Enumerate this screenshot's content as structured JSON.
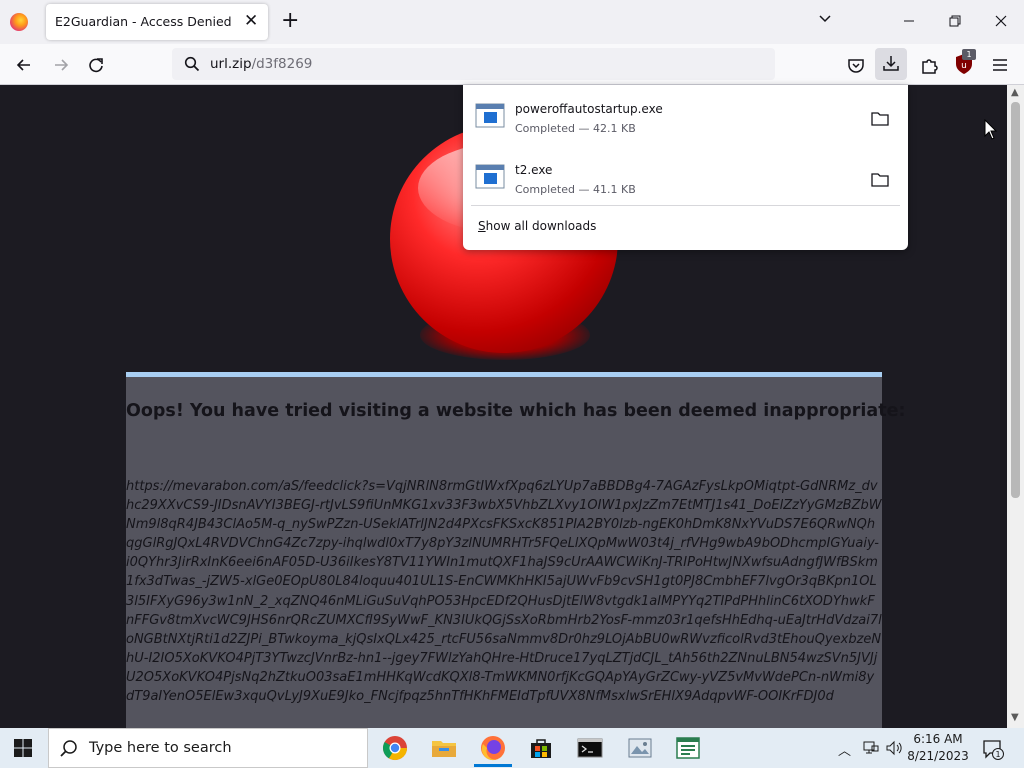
{
  "browser": {
    "tab_title": "E2Guardian - Access Denied",
    "url_host": "url.zip",
    "url_path": "/d3f8269",
    "addon_badge": "1"
  },
  "downloads": {
    "items": [
      {
        "name": "poweroffautostartup.exe",
        "status": "Completed — 42.1 KB"
      },
      {
        "name": "t2.exe",
        "status": "Completed — 41.1 KB"
      }
    ],
    "show_all_prefix": "S",
    "show_all_rest": "how all downloads"
  },
  "page": {
    "headline": "Oops! You have tried visiting a website which has been deemed inappropriate:",
    "blocked_url": "https://mevarabon.com/aS/feedclick?s=VqjNRlN8rmGtIWxfXpq6zLYUp7aBBDBg4-7AGAzFysLkpOMiqtpt-GdNRMz_dvhc29XXvCS9-JIDsnAVYI3BEGJ-rtJvLS9fiUnMKG1xv33F3wbX5VhbZLXvy1OIW1pxJzZm7EtMTJ1s41_DoElZzYyGMzBZbWNm9l8qR4JB43ClAo5M-q_nySwPZzn-USeklATrlJN2d4PXcsFKSxcK851PIA2BY0lzb-ngEK0hDmK8NxYVuDS7E6QRwNQhqgGlRgJQxL4RVDVChnG4Zc7zpy-ihqlwdl0xT7y8pY3zlNUMRHTr5FQeLlXQpMwW03t4j_rfVHg9wbA9bODhcmpIGYuaiy-i0QYhr3JirRxInK6eei6nAF05D-U36iIkesY8TV11YWIn1mutQXF1haJS9cUrAAWCWiKnJ-TRIPoHtwJNXwfsuAdngfJWfBSkm1fx3dTwas_-jZW5-xlGe0EOpU80L84loquu401UL1S-EnCWMKhHKI5ajUWvFb9cvSH1gt0PJ8CmbhEF7lvgOr3qBKpn1OL3l5IFXyG96y3w1nN_2_xqZNQ46nMLiGuSuVqhPO53HpcEDf2QHusDjtElW8vtgdk1aIMPYYq2TIPdPHhlinC6tXODYhwkFnFFGv8tmXvcWC9JHS6nrQRcZUMXCfI9SyWwF_KN3IUkQGjSsXoRbmHrb2YosF-mmz03r1qefsHhEdhq-uEaJtrHdVdzai7loNGBtNXtjRti1d2ZJPi_BTwkoyma_kjQsIxQLx425_rtcFU56saNmmv8Dr0hz9LOjAbBU0wRWvzficolRvd3tEhouQyexbzeNhU-I2IO5XoKVKO4PjT3YTwzcJVnrBz-hn1--jgey7FWlzYahQHre-HtDruce17yqLZTjdCJL_tAh56th2ZNnuLBN54wzSVn5JVJjU2O5XoKVKO4PjsNq2hZtkuO03saE1mHHKqWcdKQXl8-TmWKMN0rfjKcGQApYAyGrZCwy-yVZ5vMvWdePCn-nWmi8ydT9aIYenO5ElEw3xquQvLyJ9XuE9Jko_FNcjfpqz5hnTfHKhFMEIdTpfUVX8NfMsxlwSrEHlX9AdqpvWF-OOIKrFDJ0d"
  },
  "taskbar": {
    "search_placeholder": "Type here to search",
    "time": "6:16 AM",
    "date": "8/21/2023",
    "notification_count": "1"
  }
}
